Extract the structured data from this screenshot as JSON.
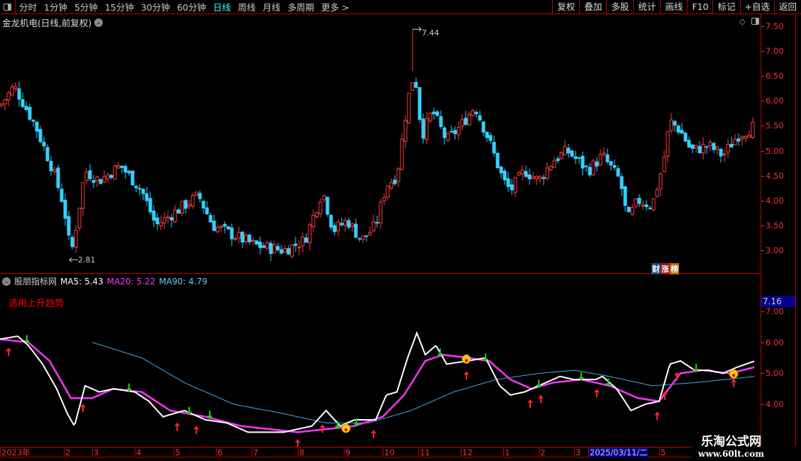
{
  "toolbar": {
    "periods": [
      "分时",
      "1分钟",
      "5分钟",
      "15分钟",
      "30分钟",
      "60分钟",
      "日线",
      "周线",
      "月线",
      "多周期",
      "更多 >"
    ],
    "active": "日线",
    "right_buttons": [
      "复权",
      "叠加",
      "多股",
      "统计",
      "画线",
      "F10",
      "标记",
      "+自选",
      "返回"
    ]
  },
  "main": {
    "title": "金龙机电(日线,前复权)",
    "high_label": "7.44",
    "low_label": "2.81",
    "fin_badge": [
      "财",
      "涨",
      "榜"
    ],
    "price_ticks": [
      "7.50",
      "7.00",
      "6.50",
      "6.00",
      "5.50",
      "5.00",
      "4.50",
      "4.00",
      "3.50",
      "3.00"
    ]
  },
  "indicator": {
    "name": "股朋指标网",
    "ma5": "MA5: 5.43",
    "ma20": "MA20: 5.22",
    "ma90": "MA90: 4.79",
    "note": "适用上升趋势",
    "current_value": "7.16",
    "ticks": [
      "7.00",
      "6.00",
      "5.00",
      "4.00"
    ]
  },
  "time_axis": [
    "2023年",
    "2",
    "3",
    "4",
    "5",
    "6",
    "7",
    "8",
    "9",
    "10",
    "11",
    "12",
    "1",
    "2",
    "3",
    "2025/03/11/二",
    "5"
  ],
  "watermark": {
    "title": "乐淘公式网",
    "url": "www.60lt.com"
  },
  "colors": {
    "up": "#ff3b3b",
    "down": "#35d0ff",
    "ma5": "#ffffff",
    "ma20": "#ff33ff",
    "ma90": "#4aa8e8"
  },
  "chart_data": {
    "type": "candlestick",
    "price_range": [
      2.7,
      7.6
    ],
    "close_keypoints": [
      [
        0,
        5.9
      ],
      [
        20,
        6.3
      ],
      [
        50,
        5.5
      ],
      [
        75,
        4.6
      ],
      [
        90,
        3.9
      ],
      [
        100,
        2.9
      ],
      [
        105,
        3.3
      ],
      [
        120,
        4.6
      ],
      [
        140,
        4.4
      ],
      [
        170,
        4.7
      ],
      [
        200,
        4.2
      ],
      [
        220,
        3.5
      ],
      [
        250,
        3.8
      ],
      [
        280,
        4.1
      ],
      [
        300,
        3.5
      ],
      [
        330,
        3.3
      ],
      [
        360,
        3.1
      ],
      [
        400,
        3.0
      ],
      [
        430,
        3.2
      ],
      [
        455,
        4.2
      ],
      [
        470,
        3.4
      ],
      [
        490,
        3.6
      ],
      [
        510,
        3.2
      ],
      [
        530,
        3.5
      ],
      [
        545,
        4.3
      ],
      [
        560,
        4.5
      ],
      [
        575,
        6.0
      ],
      [
        585,
        6.6
      ],
      [
        595,
        5.3
      ],
      [
        610,
        5.8
      ],
      [
        630,
        5.2
      ],
      [
        650,
        5.5
      ],
      [
        670,
        5.9
      ],
      [
        690,
        5.2
      ],
      [
        710,
        4.4
      ],
      [
        720,
        4.2
      ],
      [
        740,
        4.6
      ],
      [
        760,
        4.4
      ],
      [
        780,
        4.8
      ],
      [
        800,
        5.0
      ],
      [
        830,
        4.6
      ],
      [
        850,
        4.9
      ],
      [
        875,
        4.4
      ],
      [
        885,
        3.6
      ],
      [
        900,
        4.0
      ],
      [
        920,
        3.9
      ],
      [
        935,
        4.7
      ],
      [
        945,
        5.6
      ],
      [
        960,
        5.4
      ],
      [
        975,
        5.0
      ],
      [
        1000,
        5.1
      ],
      [
        1020,
        4.9
      ],
      [
        1040,
        5.3
      ],
      [
        1065,
        5.5
      ]
    ],
    "ma5_keypoints": [
      [
        0,
        6.1
      ],
      [
        25,
        6.2
      ],
      [
        40,
        5.9
      ],
      [
        60,
        5.3
      ],
      [
        80,
        4.5
      ],
      [
        95,
        3.7
      ],
      [
        105,
        3.3
      ],
      [
        120,
        4.6
      ],
      [
        140,
        4.4
      ],
      [
        160,
        4.5
      ],
      [
        190,
        4.4
      ],
      [
        210,
        4.1
      ],
      [
        230,
        3.6
      ],
      [
        260,
        3.8
      ],
      [
        290,
        3.5
      ],
      [
        320,
        3.4
      ],
      [
        350,
        3.1
      ],
      [
        400,
        3.1
      ],
      [
        440,
        3.3
      ],
      [
        460,
        3.8
      ],
      [
        480,
        3.3
      ],
      [
        500,
        3.5
      ],
      [
        530,
        3.5
      ],
      [
        545,
        4.3
      ],
      [
        560,
        4.4
      ],
      [
        575,
        5.5
      ],
      [
        588,
        6.3
      ],
      [
        600,
        5.6
      ],
      [
        615,
        5.9
      ],
      [
        630,
        5.3
      ],
      [
        660,
        5.4
      ],
      [
        685,
        5.5
      ],
      [
        705,
        4.6
      ],
      [
        720,
        4.3
      ],
      [
        740,
        4.4
      ],
      [
        760,
        4.6
      ],
      [
        790,
        4.9
      ],
      [
        810,
        4.8
      ],
      [
        840,
        4.8
      ],
      [
        850,
        4.9
      ],
      [
        870,
        4.5
      ],
      [
        890,
        3.8
      ],
      [
        910,
        4.0
      ],
      [
        930,
        4.1
      ],
      [
        945,
        5.3
      ],
      [
        960,
        5.4
      ],
      [
        980,
        5.1
      ],
      [
        1000,
        5.1
      ],
      [
        1020,
        5.0
      ],
      [
        1040,
        5.2
      ],
      [
        1065,
        5.4
      ]
    ],
    "ma20_keypoints": [
      [
        0,
        6.1
      ],
      [
        40,
        6.0
      ],
      [
        70,
        5.4
      ],
      [
        100,
        4.2
      ],
      [
        130,
        4.2
      ],
      [
        160,
        4.5
      ],
      [
        200,
        4.4
      ],
      [
        240,
        3.8
      ],
      [
        290,
        3.6
      ],
      [
        340,
        3.3
      ],
      [
        380,
        3.2
      ],
      [
        420,
        3.1
      ],
      [
        460,
        3.2
      ],
      [
        500,
        3.3
      ],
      [
        540,
        3.6
      ],
      [
        570,
        4.3
      ],
      [
        600,
        5.4
      ],
      [
        625,
        5.6
      ],
      [
        660,
        5.5
      ],
      [
        690,
        5.4
      ],
      [
        720,
        4.8
      ],
      [
        750,
        4.5
      ],
      [
        780,
        4.7
      ],
      [
        820,
        4.8
      ],
      [
        860,
        4.6
      ],
      [
        900,
        4.2
      ],
      [
        930,
        4.1
      ],
      [
        960,
        5.0
      ],
      [
        990,
        5.1
      ],
      [
        1030,
        5.0
      ],
      [
        1065,
        5.2
      ]
    ],
    "ma90_keypoints": [
      [
        130,
        6.0
      ],
      [
        200,
        5.5
      ],
      [
        260,
        4.7
      ],
      [
        330,
        4.0
      ],
      [
        400,
        3.7
      ],
      [
        460,
        3.4
      ],
      [
        520,
        3.4
      ],
      [
        580,
        3.8
      ],
      [
        640,
        4.4
      ],
      [
        700,
        4.8
      ],
      [
        760,
        5.0
      ],
      [
        810,
        5.1
      ],
      [
        860,
        4.9
      ],
      [
        920,
        4.6
      ],
      [
        980,
        4.7
      ],
      [
        1065,
        4.9
      ]
    ],
    "up_arrows": [
      12,
      117,
      250,
      277,
      420,
      455,
      527,
      658,
      748,
      763,
      842,
      927,
      938,
      955,
      1035
    ],
    "down_arrows": [
      38,
      182,
      267,
      296,
      476,
      503,
      621,
      685,
      760,
      820,
      858,
      982
    ],
    "face_markers": [
      488,
      658,
      1035
    ],
    "high_point": [
      582,
      7.44
    ],
    "low_point": [
      100,
      2.81
    ]
  }
}
